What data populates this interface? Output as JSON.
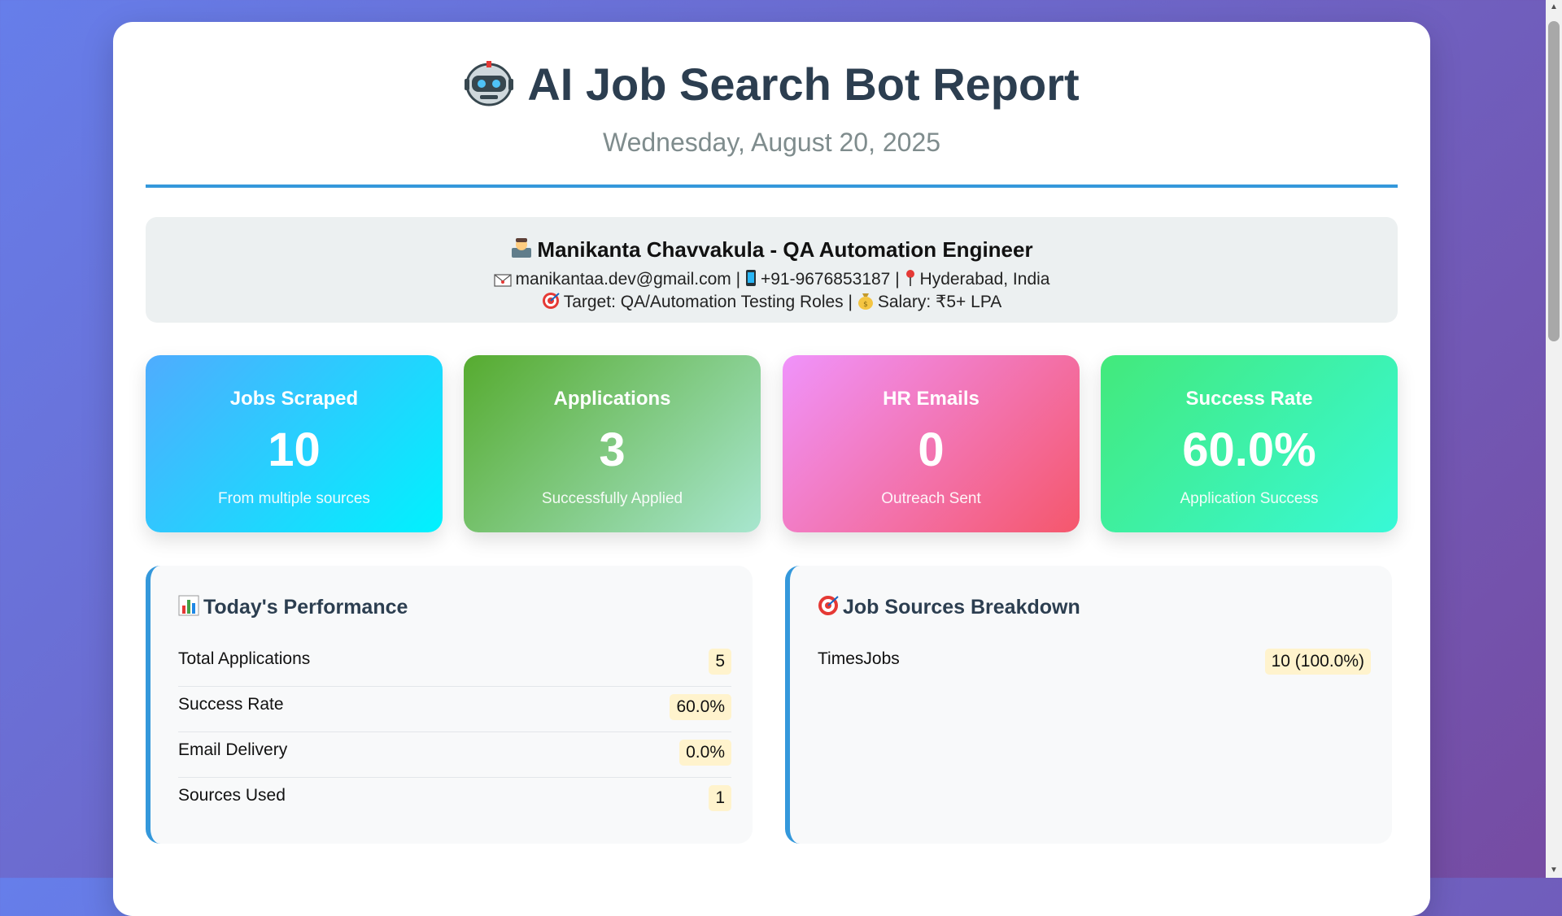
{
  "header": {
    "title": "AI Job Search Bot Report",
    "title_icon": "robot-icon",
    "date": "Wednesday, August 20, 2025"
  },
  "profile": {
    "name_line": "Manikanta Chavvakula - QA Automation Engineer",
    "email": "manikantaa.dev@gmail.com",
    "phone": "+91-9676853187",
    "location": "Hyderabad, India",
    "target": "Target: QA/Automation Testing Roles",
    "salary": "Salary: ₹5+ LPA",
    "separator": "|",
    "icons": [
      "technologist-icon",
      "envelope-icon",
      "phone-icon",
      "pin-icon",
      "target-icon",
      "money-bag-icon"
    ]
  },
  "stats": [
    {
      "label": "Jobs Scraped",
      "value": "10",
      "sub": "From multiple sources"
    },
    {
      "label": "Applications",
      "value": "3",
      "sub": "Successfully Applied"
    },
    {
      "label": "HR Emails",
      "value": "0",
      "sub": "Outreach Sent"
    },
    {
      "label": "Success Rate",
      "value": "60.0%",
      "sub": "Application Success"
    }
  ],
  "performance": {
    "title": "Today's Performance",
    "icon": "bar-chart-icon",
    "rows": [
      {
        "name": "Total Applications",
        "value": "5"
      },
      {
        "name": "Success Rate",
        "value": "60.0%"
      },
      {
        "name": "Email Delivery",
        "value": "0.0%"
      },
      {
        "name": "Sources Used",
        "value": "1"
      }
    ]
  },
  "sources": {
    "title": "Job Sources Breakdown",
    "icon": "target-icon",
    "rows": [
      {
        "name": "TimesJobs",
        "value": "10 (100.0%)"
      }
    ]
  },
  "colors": {
    "accent": "#3498db",
    "heading": "#2c3e50",
    "badge_bg": "#fff3cd"
  }
}
